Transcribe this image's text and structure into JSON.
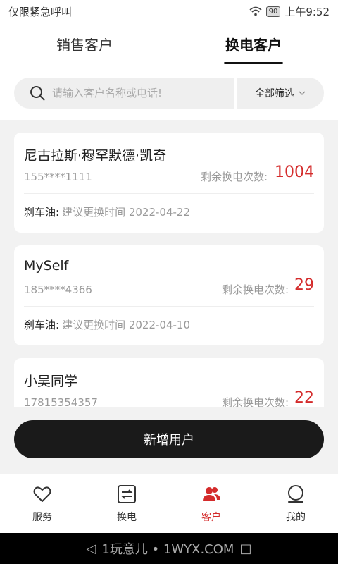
{
  "status_bar": {
    "left_text": "仅限紧急呼叫",
    "battery": "90",
    "time": "上午9:52"
  },
  "tabs": [
    {
      "label": "销售客户",
      "active": false
    },
    {
      "label": "换电客户",
      "active": true
    }
  ],
  "search": {
    "placeholder": "请输入客户名称或电话!",
    "value": "",
    "filter_label": "全部筛选"
  },
  "customers": [
    {
      "name": "尼古拉斯·穆罕默德·凯奇",
      "phone": "155****1111",
      "count_label": "剩余换电次数:",
      "count": "1004",
      "footer_key": "刹车油:",
      "footer_value": "建议更换时间 2022-04-22"
    },
    {
      "name": "MySelf",
      "phone": "185****4366",
      "count_label": "剩余换电次数:",
      "count": "29",
      "footer_key": "刹车油:",
      "footer_value": "建议更换时间 2022-04-10"
    },
    {
      "name": "小吴同学",
      "phone": "17815354357",
      "count_label": "剩余换电次数:",
      "count": "22"
    }
  ],
  "add_button": "新增用户",
  "bottom_nav": [
    {
      "label": "服务",
      "icon": "heart-icon",
      "active": false
    },
    {
      "label": "换电",
      "icon": "swap-icon",
      "active": false
    },
    {
      "label": "客户",
      "icon": "users-icon",
      "active": true
    },
    {
      "label": "我的",
      "icon": "profile-icon",
      "active": false
    }
  ],
  "system_bar": {
    "watermark": "1玩意儿 • 1WYX.COM"
  },
  "colors": {
    "accent": "#d42b2b",
    "button": "#1a1a1a"
  }
}
